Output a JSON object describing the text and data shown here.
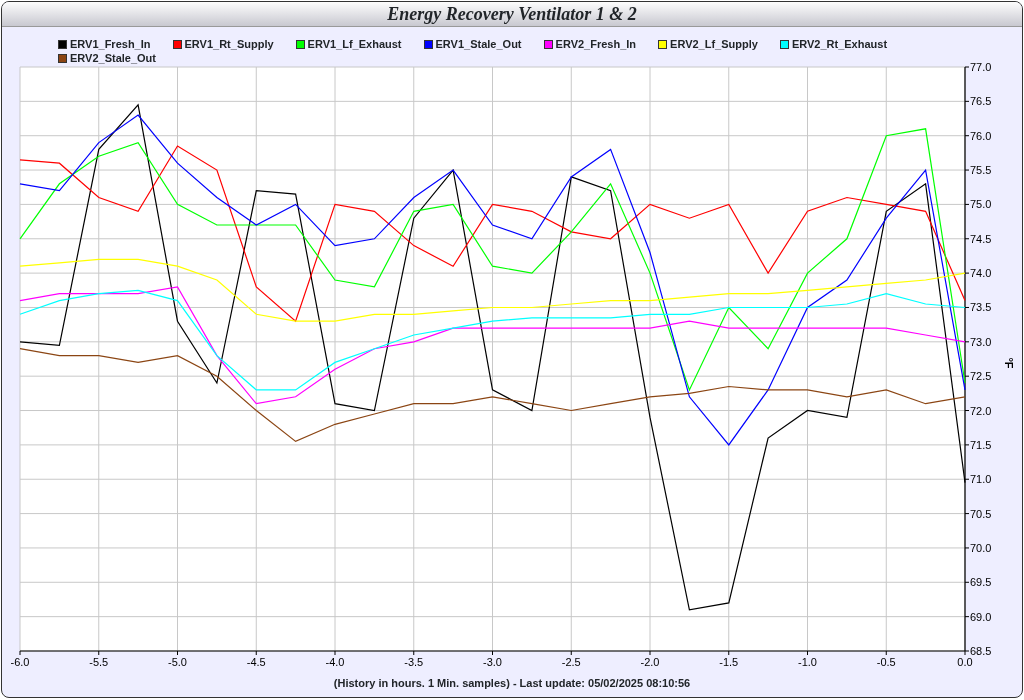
{
  "window": {
    "title": "Energy Recovery Ventilator 1 & 2"
  },
  "chart_data": {
    "type": "line",
    "xlabel": "(History in hours. 1 Min. samples) - Last update: 05/02/2025 08:10:56",
    "ylabel": "°F",
    "x": [
      -6,
      -5.75,
      -5.5,
      -5.25,
      -5,
      -4.75,
      -4.5,
      -4.25,
      -4,
      -3.75,
      -3.5,
      -3.25,
      -3,
      -2.75,
      -2.5,
      -2.25,
      -2,
      -1.75,
      -1.5,
      -1.25,
      -1,
      -0.75,
      -0.5,
      -0.25,
      0
    ],
    "series": [
      {
        "name": "ERV1_Fresh_In",
        "color": "#000000",
        "values": [
          73.0,
          72.95,
          75.8,
          76.45,
          73.3,
          72.4,
          75.2,
          75.15,
          72.1,
          72.0,
          74.8,
          75.5,
          72.3,
          72.0,
          75.4,
          75.2,
          71.9,
          69.1,
          69.2,
          71.6,
          72.0,
          71.9,
          74.9,
          75.3,
          70.95
        ]
      },
      {
        "name": "ERV1_Rt_Supply",
        "color": "#ff0000",
        "values": [
          75.65,
          75.6,
          75.1,
          74.9,
          75.85,
          75.5,
          73.8,
          73.3,
          75.0,
          74.9,
          74.4,
          74.1,
          75.0,
          74.9,
          74.6,
          74.5,
          75.0,
          74.8,
          75.0,
          74.0,
          74.9,
          75.1,
          75.0,
          74.9,
          73.6
        ]
      },
      {
        "name": "ERV1_Lf_Exhaust",
        "color": "#00ff00",
        "values": [
          74.5,
          75.3,
          75.7,
          75.9,
          75.0,
          74.7,
          74.7,
          74.7,
          73.9,
          73.8,
          74.9,
          75.0,
          74.1,
          74.0,
          74.6,
          75.3,
          74.0,
          72.3,
          73.5,
          72.9,
          74.0,
          74.5,
          76.0,
          76.1,
          72.4
        ]
      },
      {
        "name": "ERV1_Stale_Out",
        "color": "#0000ff",
        "values": [
          75.3,
          75.2,
          75.9,
          76.3,
          75.6,
          75.1,
          74.7,
          75.0,
          74.4,
          74.5,
          75.1,
          75.5,
          74.7,
          74.5,
          75.4,
          75.8,
          74.3,
          72.2,
          71.5,
          72.3,
          73.5,
          73.9,
          74.8,
          75.5,
          72.3
        ]
      },
      {
        "name": "ERV2_Fresh_In",
        "color": "#ff00ff",
        "values": [
          73.6,
          73.7,
          73.7,
          73.7,
          73.8,
          72.8,
          72.1,
          72.2,
          72.6,
          72.9,
          73.0,
          73.2,
          73.2,
          73.2,
          73.2,
          73.2,
          73.2,
          73.3,
          73.2,
          73.2,
          73.2,
          73.2,
          73.2,
          73.1,
          73.0
        ]
      },
      {
        "name": "ERV2_Lf_Supply",
        "color": "#ffff00",
        "values": [
          74.1,
          74.15,
          74.2,
          74.2,
          74.1,
          73.9,
          73.4,
          73.3,
          73.3,
          73.4,
          73.4,
          73.45,
          73.5,
          73.5,
          73.55,
          73.6,
          73.6,
          73.65,
          73.7,
          73.7,
          73.75,
          73.8,
          73.85,
          73.9,
          74.0
        ]
      },
      {
        "name": "ERV2_Rt_Exhaust",
        "color": "#00ffff",
        "values": [
          73.4,
          73.6,
          73.7,
          73.75,
          73.6,
          72.8,
          72.3,
          72.3,
          72.7,
          72.9,
          73.1,
          73.2,
          73.3,
          73.35,
          73.35,
          73.35,
          73.4,
          73.4,
          73.5,
          73.5,
          73.5,
          73.55,
          73.7,
          73.55,
          73.5
        ]
      },
      {
        "name": "ERV2_Stale_Out",
        "color": "#8b4513",
        "values": [
          72.9,
          72.8,
          72.8,
          72.7,
          72.8,
          72.5,
          72.0,
          71.55,
          71.8,
          71.95,
          72.1,
          72.1,
          72.2,
          72.1,
          72.0,
          72.1,
          72.2,
          72.25,
          72.35,
          72.3,
          72.3,
          72.2,
          72.3,
          72.1,
          72.2
        ]
      }
    ],
    "grid": true,
    "xlim": [
      -6,
      0
    ],
    "ylim": [
      68.5,
      77
    ],
    "xticks": [
      {
        "value": -6,
        "label": "-6.0"
      },
      {
        "value": -5.5,
        "label": "-5.5"
      },
      {
        "value": -5,
        "label": "-5.0"
      },
      {
        "value": -4.5,
        "label": "-4.5"
      },
      {
        "value": -4,
        "label": "-4.0"
      },
      {
        "value": -3.5,
        "label": "-3.5"
      },
      {
        "value": -3,
        "label": "-3.0"
      },
      {
        "value": -2.5,
        "label": "-2.5"
      },
      {
        "value": -2,
        "label": "-2.0"
      },
      {
        "value": -1.5,
        "label": "-1.5"
      },
      {
        "value": -1,
        "label": "-1.0"
      },
      {
        "value": -0.5,
        "label": "-0.5"
      },
      {
        "value": 0,
        "label": "0.0"
      }
    ],
    "yticks": [
      {
        "value": 68.5,
        "label": "68.5"
      },
      {
        "value": 69,
        "label": "69.0"
      },
      {
        "value": 69.5,
        "label": "69.5"
      },
      {
        "value": 70,
        "label": "70.0"
      },
      {
        "value": 70.5,
        "label": "70.5"
      },
      {
        "value": 71,
        "label": "71.0"
      },
      {
        "value": 71.5,
        "label": "71.5"
      },
      {
        "value": 72,
        "label": "72.0"
      },
      {
        "value": 72.5,
        "label": "72.5"
      },
      {
        "value": 73,
        "label": "73.0"
      },
      {
        "value": 73.5,
        "label": "73.5"
      },
      {
        "value": 74,
        "label": "74.0"
      },
      {
        "value": 74.5,
        "label": "74.5"
      },
      {
        "value": 75,
        "label": "75.0"
      },
      {
        "value": 75.5,
        "label": "75.5"
      },
      {
        "value": 76,
        "label": "76.0"
      },
      {
        "value": 76.5,
        "label": "76.5"
      },
      {
        "value": 77,
        "label": "77.0"
      }
    ]
  }
}
